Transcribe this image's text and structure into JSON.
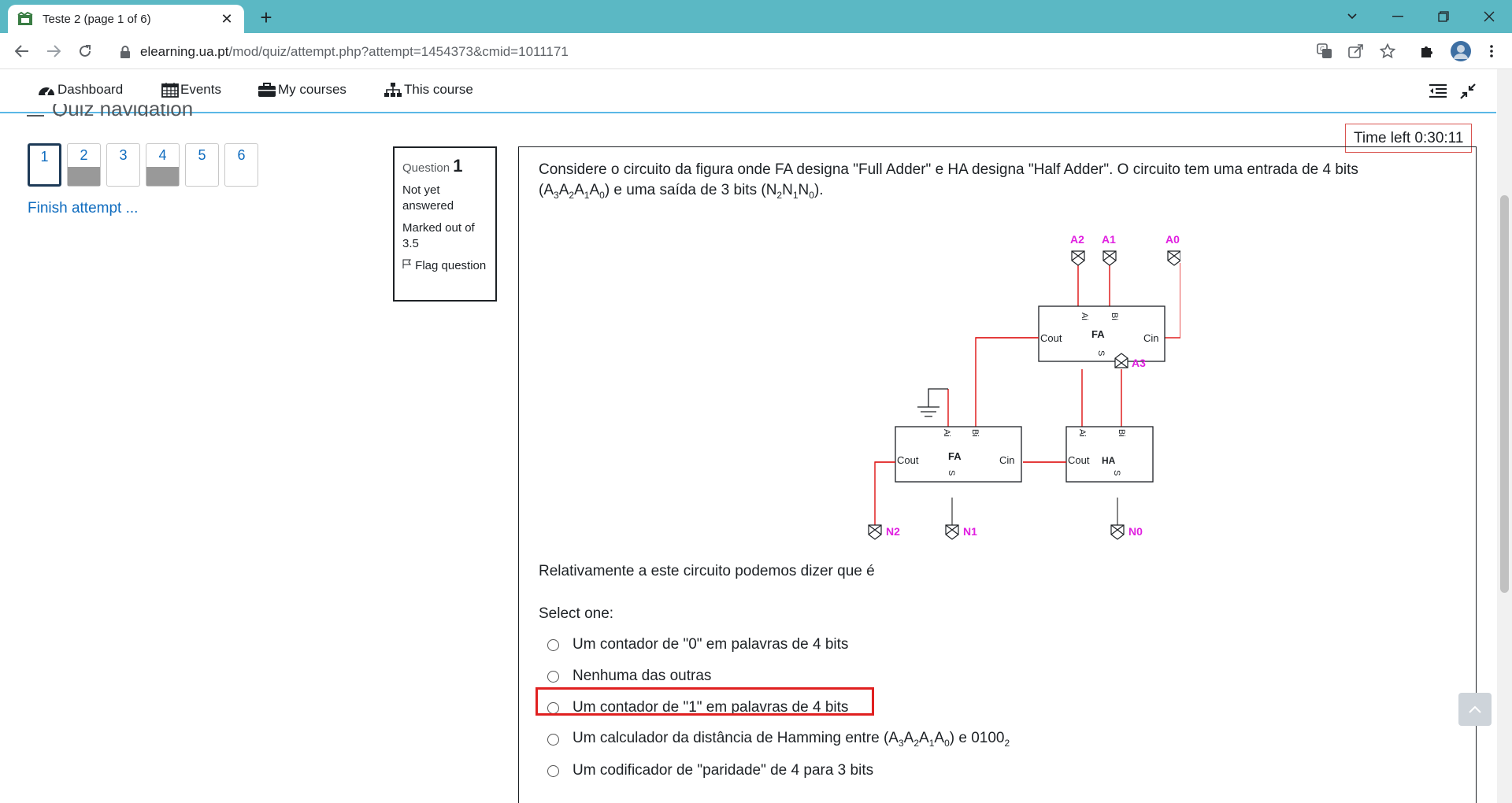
{
  "browser": {
    "tab_title": "Teste 2 (page 1 of 6)",
    "url_host": "elearning.ua.pt",
    "url_path": "/mod/quiz/attempt.php?attempt=1454373&cmid=1011171"
  },
  "navbar": {
    "items": [
      {
        "label": "Dashboard",
        "icon": "dashboard-icon"
      },
      {
        "label": "Events",
        "icon": "calendar-icon"
      },
      {
        "label": "My courses",
        "icon": "briefcase-icon"
      },
      {
        "label": "This course",
        "icon": "sitemap-icon"
      }
    ]
  },
  "quiz_nav": {
    "title": "Quiz navigation",
    "questions": [
      {
        "num": "1",
        "state": "current"
      },
      {
        "num": "2",
        "state": "answered"
      },
      {
        "num": "3",
        "state": "notanswered"
      },
      {
        "num": "4",
        "state": "answered"
      },
      {
        "num": "5",
        "state": "notanswered"
      },
      {
        "num": "6",
        "state": "notanswered"
      }
    ],
    "finish_link": "Finish attempt ..."
  },
  "question_info": {
    "label": "Question",
    "number": "1",
    "status": "Not yet answered",
    "marked": "Marked out of 3.5",
    "flag": "Flag question"
  },
  "timer": "Time left 0:30:11",
  "question": {
    "text_a": "Considere o circuito da figura onde FA designa \"Full Adder\" e HA designa \"Half Adder\". O circuito tem uma  entrada de 4 bits",
    "prompt": "Relativamente a este circuito podemos dizer que é",
    "select_one": "Select one:",
    "circuit": {
      "inputs": [
        "A2",
        "A1",
        "A0",
        "A3"
      ],
      "outputs": [
        "N2",
        "N1",
        "N0"
      ],
      "fa_label": "FA",
      "ha_label": "HA",
      "cout": "Cout",
      "cin": "Cin",
      "ai": "Ai",
      "bi": "Bi",
      "s": "S"
    },
    "answers": [
      {
        "text": "Um contador de \"0\" em palavras de 4 bits"
      },
      {
        "text": "Nenhuma das outras"
      },
      {
        "text": "Um contador de \"1\" em palavras de 4 bits"
      },
      {
        "text_prefix": "Um calculador da distância de Hamming  entre (A"
      },
      {
        "text": "Um codificador de \"paridade\" de 4 para 3 bits"
      }
    ]
  },
  "colors": {
    "accent": "#0f6cbf",
    "tabbar": "#5bb8c4",
    "wire": "#e02020",
    "io_label": "#e020e0"
  }
}
